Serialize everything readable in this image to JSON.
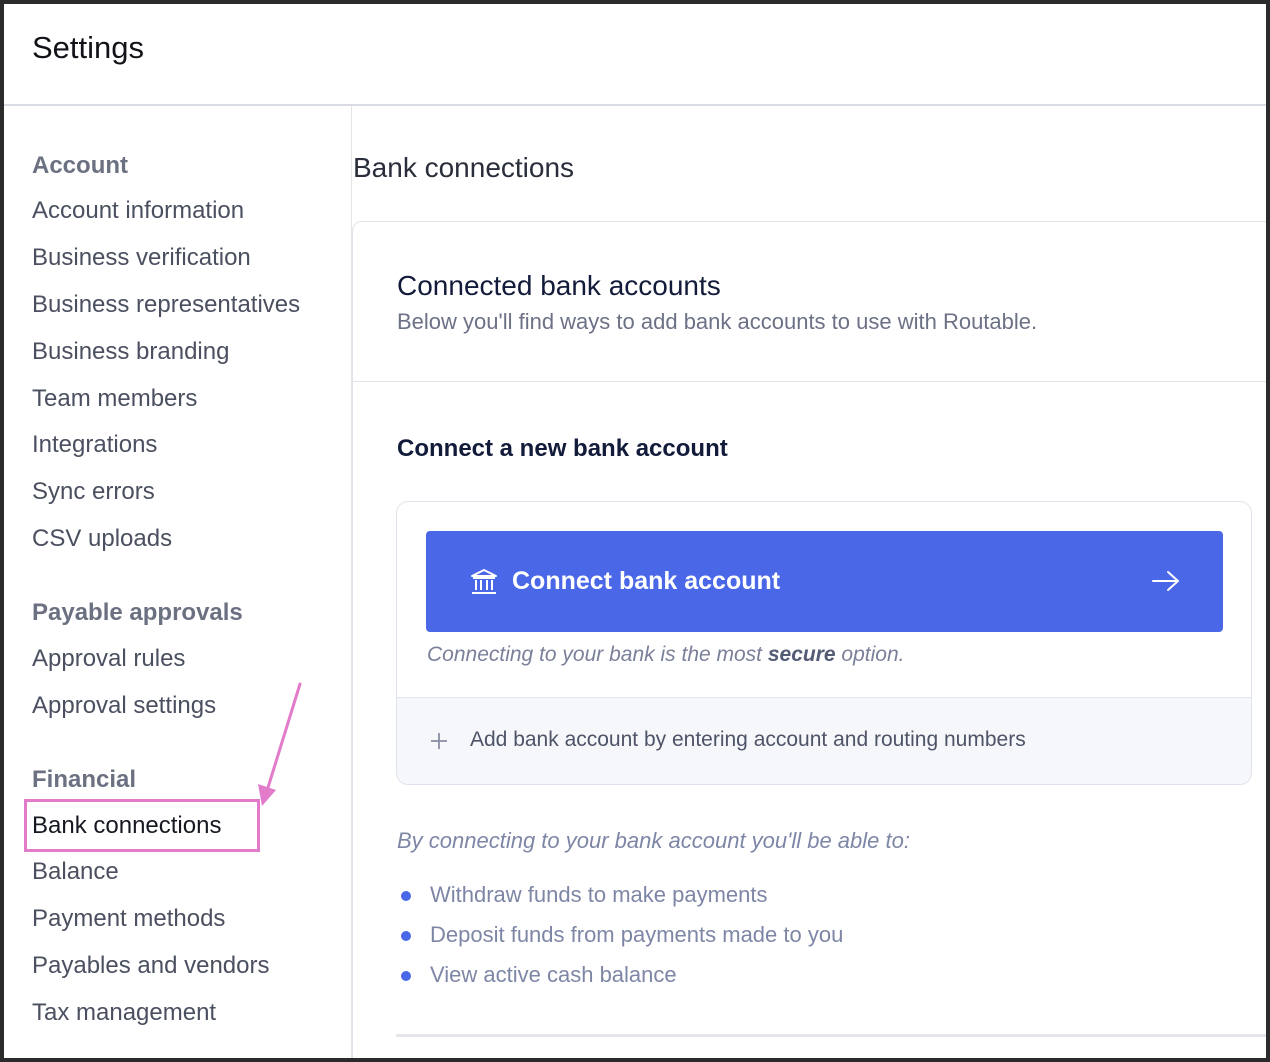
{
  "header": {
    "title": "Settings"
  },
  "sidebar": {
    "sections": [
      {
        "heading": "Account",
        "items": [
          "Account information",
          "Business verification",
          "Business representatives",
          "Business branding",
          "Team members",
          "Integrations",
          "Sync errors",
          "CSV uploads"
        ]
      },
      {
        "heading": "Payable approvals",
        "items": [
          "Approval rules",
          "Approval settings"
        ]
      },
      {
        "heading": "Financial",
        "items": [
          "Bank connections",
          "Balance",
          "Payment methods",
          "Payables and vendors",
          "Tax management"
        ]
      }
    ],
    "active_item": "Bank connections"
  },
  "main": {
    "page_title": "Bank connections",
    "panel": {
      "title": "Connected bank accounts",
      "subtitle": "Below you'll find ways to add bank accounts to use with Routable."
    },
    "connect": {
      "title": "Connect a new bank account",
      "button_label": "Connect bank account",
      "note_before": "Connecting to your bank is the most ",
      "note_bold": "secure",
      "note_after": " option.",
      "manual_label": "Add bank account by entering account and routing numbers"
    },
    "benefits": {
      "intro": "By connecting to your bank account you'll be able to:",
      "items": [
        "Withdraw funds to make payments",
        "Deposit funds from payments made to you",
        "View active cash balance"
      ]
    }
  },
  "colors": {
    "accent": "#4a67e8",
    "annotation": "#e27bc9"
  },
  "icons": {
    "bank": "bank-icon",
    "arrow": "arrow-right-icon",
    "plus": "plus-icon",
    "annotation": "annotation-arrow-icon"
  }
}
